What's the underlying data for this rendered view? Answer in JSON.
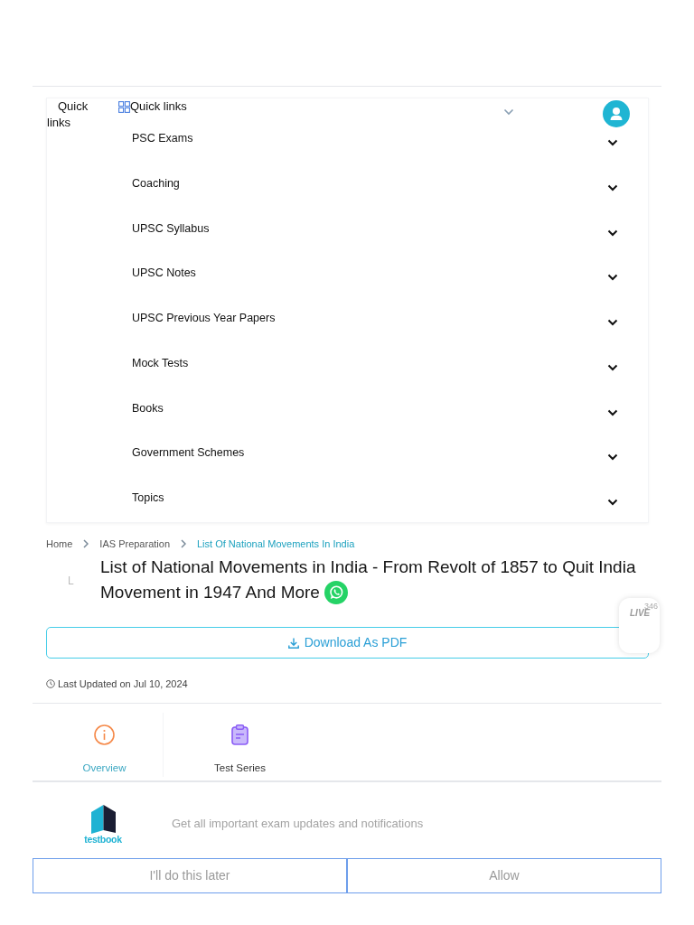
{
  "header": {
    "side_label": "Quick links",
    "menu_label": "Quick links"
  },
  "quick_links": {
    "items": [
      {
        "label": "PSC Exams",
        "expanded": false
      },
      {
        "label": "Coaching",
        "expanded": false
      },
      {
        "label": "UPSC Syllabus",
        "expanded": false
      },
      {
        "label": "UPSC Notes",
        "expanded": false
      },
      {
        "label": "UPSC Previous Year Papers",
        "expanded": false
      },
      {
        "label": "Mock Tests",
        "expanded": false
      },
      {
        "label": "Books",
        "expanded": false
      },
      {
        "label": "Government Schemes",
        "expanded": false
      },
      {
        "label": "Topics",
        "expanded": false
      }
    ]
  },
  "breadcrumb": [
    {
      "label": "Home",
      "selected": false
    },
    {
      "label": "IAS Preparation",
      "selected": false
    },
    {
      "label": "List Of National Movements In India",
      "selected": true
    }
  ],
  "article": {
    "side_letter": "L",
    "title": "List of National Movements in India - From Revolt of 1857 to Quit India Movement in 1947 And More",
    "download_button": "Download As PDF",
    "last_updated": "Last Updated on Jul 10, 2024"
  },
  "live_badge": {
    "label": "LIVE",
    "count": "346"
  },
  "tabs": [
    {
      "label": "Overview",
      "kind": "info",
      "selected": true
    },
    {
      "label": "Test Series",
      "kind": "clipboard",
      "selected": false
    }
  ],
  "notification_prompt": {
    "logo_text": "testbook",
    "message": "Get all important exam updates and notifications",
    "buttons": [
      "I'll do this later",
      "Allow"
    ]
  }
}
